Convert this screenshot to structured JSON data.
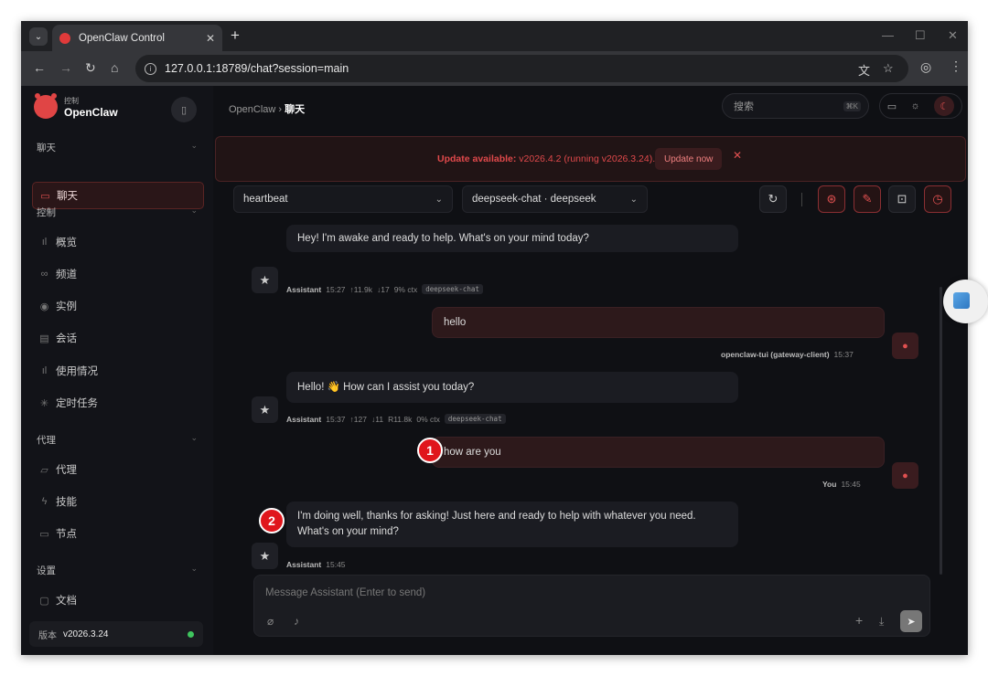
{
  "browser": {
    "tab_title": "OpenClaw Control",
    "url": "127.0.0.1:18789/chat?session=main"
  },
  "sidebar": {
    "brand_small": "控制",
    "brand_name": "OpenClaw",
    "sections": [
      "聊天",
      "控制",
      "代理",
      "设置"
    ],
    "items": [
      {
        "label": "聊天",
        "icon": "chat-icon"
      },
      {
        "label": "概览",
        "icon": "bar-chart-icon"
      },
      {
        "label": "频道",
        "icon": "link-icon"
      },
      {
        "label": "实例",
        "icon": "broadcast-icon"
      },
      {
        "label": "会话",
        "icon": "document-icon"
      },
      {
        "label": "使用情况",
        "icon": "bar-chart-icon"
      },
      {
        "label": "定时任务",
        "icon": "loader-icon"
      },
      {
        "label": "代理",
        "icon": "folder-icon"
      },
      {
        "label": "技能",
        "icon": "lightning-icon"
      },
      {
        "label": "节点",
        "icon": "monitor-icon"
      },
      {
        "label": "文档",
        "icon": "book-icon"
      }
    ],
    "version_label": "版本",
    "version": "v2026.3.24"
  },
  "header": {
    "breadcrumb_root": "OpenClaw",
    "breadcrumb_current": "聊天",
    "search_placeholder": "搜索",
    "search_shortcut": "⌘K"
  },
  "banner": {
    "prefix": "Update available:",
    "text": " v2026.4.2 (running v2026.3.24).",
    "button": "Update now"
  },
  "toolbar": {
    "session_select": "heartbeat",
    "model_select": "deepseek-chat · deepseek"
  },
  "messages": [
    {
      "role": "assistant",
      "text": "Hey! I'm awake and ready to help. What's on your mind today?",
      "meta_name": "Assistant",
      "meta": [
        "15:27",
        "↑11.9k",
        "↓17",
        "9% ctx"
      ],
      "tag": "deepseek-chat"
    },
    {
      "role": "user",
      "text": "hello",
      "meta_name": "openclaw-tui (gateway-client)",
      "time": "15:37"
    },
    {
      "role": "assistant",
      "text": "Hello! 👋 How can I assist you today?",
      "meta_name": "Assistant",
      "meta": [
        "15:37",
        "↑127",
        "↓11",
        "R11.8k",
        "0% ctx"
      ],
      "tag": "deepseek-chat"
    },
    {
      "role": "user",
      "text": "how are you",
      "meta_name": "You",
      "time": "15:45"
    },
    {
      "role": "assistant",
      "text": "I'm doing well, thanks for asking! Just here and ready to help with whatever you need. What's on your mind?",
      "meta_name": "Assistant",
      "time": "15:45"
    }
  ],
  "annotations": [
    "1",
    "2"
  ],
  "composer": {
    "placeholder": "Message Assistant (Enter to send)"
  },
  "colors": {
    "accent": "#e05050",
    "background": "#0f1014",
    "sidebar": "#121318",
    "annotation": "#e0161c"
  }
}
